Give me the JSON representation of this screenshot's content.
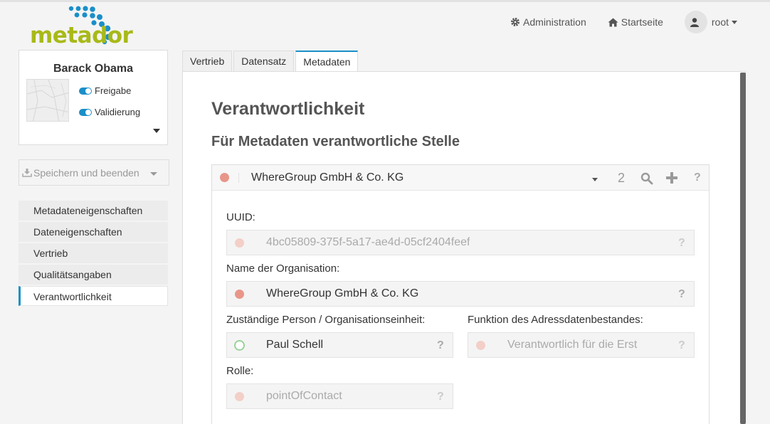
{
  "logo": {
    "text": "metador"
  },
  "header": {
    "admin_label": "Administration",
    "home_label": "Startseite",
    "user_label": "root"
  },
  "profile": {
    "name": "Barack Obama",
    "toggles": [
      {
        "label": "Freigabe",
        "on": true
      },
      {
        "label": "Validierung",
        "on": true
      }
    ]
  },
  "save_button": {
    "label": "Speichern und beenden"
  },
  "sidenav": {
    "items": [
      {
        "label": "Metadateneigenschaften",
        "active": false
      },
      {
        "label": "Dateneigenschaften",
        "active": false
      },
      {
        "label": "Vertrieb",
        "active": false
      },
      {
        "label": "Qualitätsangaben",
        "active": false
      },
      {
        "label": "Verantwortlichkeit",
        "active": true
      }
    ]
  },
  "tabs": [
    {
      "label": "Vertrieb",
      "active": false
    },
    {
      "label": "Datensatz",
      "active": false
    },
    {
      "label": "Metadaten",
      "active": true
    }
  ],
  "content": {
    "title": "Verantwortlichkeit",
    "subtitle": "Für Metadaten verantwortliche Stelle",
    "org_select": {
      "value": "WhereGroup GmbH & Co. KG",
      "count": "2",
      "help": "?"
    },
    "fields": {
      "uuid": {
        "label": "UUID:",
        "value": "4bc05809-375f-5a17-ae4d-05cf2404feef",
        "help": "?"
      },
      "organisation": {
        "label": "Name der Organisation:",
        "value": "WhereGroup GmbH & Co. KG",
        "help": "?"
      },
      "person": {
        "label": "Zuständige Person / Organisationseinheit:",
        "value": "Paul Schell",
        "help": "?"
      },
      "function": {
        "label": "Funktion des Adressdatenbestandes:",
        "value": "Verantwortlich für die Erst",
        "help": "?"
      },
      "role": {
        "label": "Rolle:",
        "value": "pointOfContact",
        "help": "?"
      }
    }
  },
  "colors": {
    "accent": "#1a8fc9",
    "logo_green": "#a8b919",
    "status_red": "#e8968a",
    "status_pale": "#f3cfc8",
    "status_ring": "#9ad39a"
  }
}
